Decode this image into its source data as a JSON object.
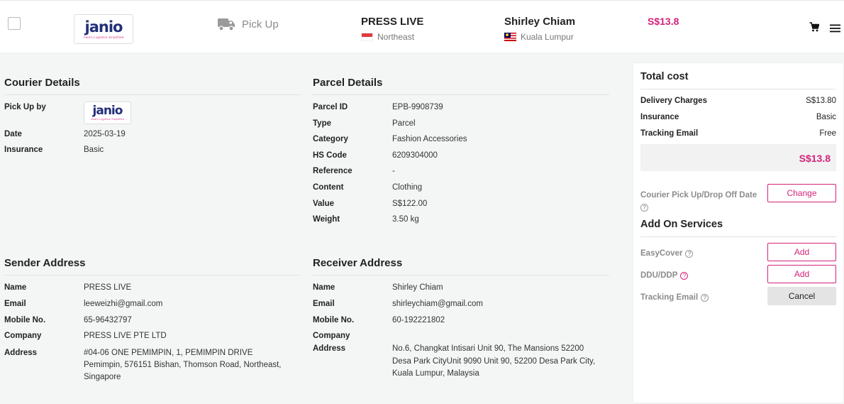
{
  "header": {
    "logo_text": "janio",
    "logo_tagline": "Asia's Logistics Simplified",
    "service_type": "Pick Up",
    "sender": {
      "name": "PRESS LIVE",
      "region": "Northeast"
    },
    "receiver": {
      "name": "Shirley Chiam",
      "region": "Kuala Lumpur"
    },
    "price": "S$13.8",
    "icons": [
      "checkbox",
      "truck-icon",
      "singapore-flag-icon",
      "malaysia-flag-icon",
      "cart-icon",
      "menu-icon"
    ]
  },
  "courier": {
    "title": "Courier Details",
    "rows": [
      {
        "label": "Pick Up by",
        "value": ""
      },
      {
        "label": "Date",
        "value": "2025-03-19"
      },
      {
        "label": "Insurance",
        "value": "Basic"
      }
    ]
  },
  "parcel": {
    "title": "Parcel Details",
    "rows": [
      {
        "label": "Parcel ID",
        "value": "EPB-9908739"
      },
      {
        "label": "Type",
        "value": "Parcel"
      },
      {
        "label": "Category",
        "value": "Fashion Accessories"
      },
      {
        "label": "HS Code",
        "value": "6209304000"
      },
      {
        "label": "Reference",
        "value": "-"
      },
      {
        "label": "Content",
        "value": "Clothing"
      },
      {
        "label": "Value",
        "value": "S$122.00"
      },
      {
        "label": "Weight",
        "value": "3.50 kg"
      }
    ]
  },
  "sender_address": {
    "title": "Sender Address",
    "rows": [
      {
        "label": "Name",
        "value": "PRESS LIVE"
      },
      {
        "label": "Email",
        "value": "leeweizhi@gmail.com"
      },
      {
        "label": "Mobile No.",
        "value": "65-96432797"
      },
      {
        "label": "Company",
        "value": "PRESS LIVE PTE LTD"
      },
      {
        "label": "Address",
        "value": "#04-06 ONE PEMIMPIN, 1, PEMIMPIN DRIVE Pemimpin, 576151 Bishan, Thomson Road, Northeast, Singapore"
      }
    ]
  },
  "receiver_address": {
    "title": "Receiver Address",
    "rows": [
      {
        "label": "Name",
        "value": "Shirley Chiam"
      },
      {
        "label": "Email",
        "value": "shirleychiam@gmail.com"
      },
      {
        "label": "Mobile No.",
        "value": "60-192221802"
      },
      {
        "label": "Company",
        "value": ""
      },
      {
        "label": "Address",
        "value": "No.6, Changkat Intisari Unit 90, The Mansions 52200 Desa Park CityUnit 9090 Unit 90, 52200 Desa Park City, Kuala Lumpur, Malaysia"
      }
    ]
  },
  "cost": {
    "title": "Total cost",
    "rows": [
      {
        "label": "Delivery Charges",
        "value": "S$13.80"
      },
      {
        "label": "Insurance",
        "value": "Basic"
      },
      {
        "label": "Tracking Email",
        "value": "Free"
      }
    ],
    "total": "S$13.8",
    "pickup_date_label": "Courier Pick Up/Drop Off Date",
    "change_label": "Change"
  },
  "addons": {
    "title": "Add On Services",
    "items": [
      {
        "label": "EasyCover",
        "action": "Add"
      },
      {
        "label": "DDU/DDP",
        "action": "Add"
      },
      {
        "label": "Tracking Email",
        "action": "Cancel"
      }
    ]
  },
  "colors": {
    "accent": "#d4237a",
    "brand_navy": "#23307a",
    "background": "#f4f6f6"
  }
}
